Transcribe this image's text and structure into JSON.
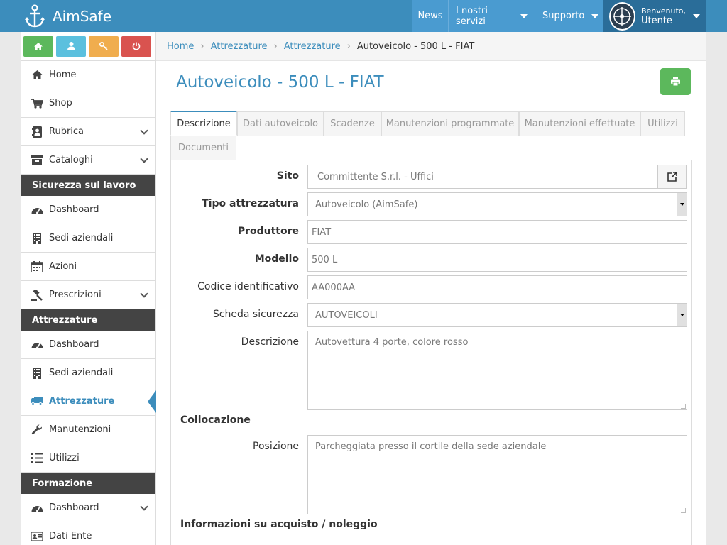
{
  "app": {
    "name": "AimSafe"
  },
  "topnav": {
    "news": "News",
    "services": "I nostri servizi",
    "support": "Supporto",
    "welcome": "Benvenuto,",
    "user": "Utente"
  },
  "sidebar": {
    "items_top": [
      {
        "label": "Home",
        "icon": "home-icon"
      },
      {
        "label": "Shop",
        "icon": "cart-icon"
      },
      {
        "label": "Rubrica",
        "icon": "address-book-icon"
      },
      {
        "label": "Cataloghi",
        "icon": "archive-icon"
      }
    ],
    "section1": "Sicurezza sul lavoro",
    "items_sec1": [
      {
        "label": "Dashboard"
      },
      {
        "label": "Sedi aziendali"
      },
      {
        "label": "Azioni"
      },
      {
        "label": "Prescrizioni"
      }
    ],
    "section2": "Attrezzature",
    "items_sec2": [
      {
        "label": "Dashboard"
      },
      {
        "label": "Sedi aziendali"
      },
      {
        "label": "Attrezzature"
      },
      {
        "label": "Manutenzioni"
      },
      {
        "label": "Utilizzi"
      }
    ],
    "section3": "Formazione",
    "items_sec3": [
      {
        "label": "Dashboard"
      },
      {
        "label": "Dati Ente"
      }
    ]
  },
  "breadcrumb": [
    "Home",
    "Attrezzature",
    "Attrezzature",
    "Autoveicolo - 500 L - FIAT"
  ],
  "page": {
    "title": "Autoveicolo - 500 L - FIAT"
  },
  "tabs": [
    "Descrizione",
    "Dati autoveicolo",
    "Scadenze",
    "Manutenzioni programmate",
    "Manutenzioni effettuate",
    "Utilizzi",
    "Documenti"
  ],
  "form": {
    "sito_label": "Sito",
    "sito_value": "Committente S.r.l. - Uffici",
    "tipo_label": "Tipo attrezzatura",
    "tipo_value": "Autoveicolo (AimSafe)",
    "produttore_label": "Produttore",
    "produttore_value": "FIAT",
    "modello_label": "Modello",
    "modello_value": "500 L",
    "codice_label": "Codice identificativo",
    "codice_value": "AA000AA",
    "scheda_label": "Scheda sicurezza",
    "scheda_value": "AUTOVEICOLI",
    "descrizione_label": "Descrizione",
    "descrizione_value": "Autovettura 4 porte, colore rosso",
    "collocazione_heading": "Collocazione",
    "posizione_label": "Posizione",
    "posizione_value": "Parcheggiata presso il cortile della sede aziendale",
    "acquisto_heading": "Informazioni su acquisto / noleggio"
  },
  "colors": {
    "brand": "#3c8dbc",
    "success": "#5cb85c",
    "info": "#5bc0de",
    "warning": "#f0ad4e",
    "danger": "#d9534f",
    "sidebar_header": "#444444"
  }
}
